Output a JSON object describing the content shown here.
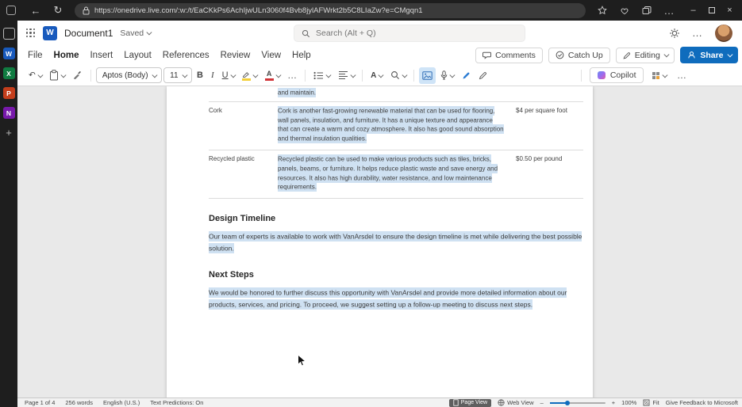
{
  "colors": {
    "accent": "#0f6cbd",
    "highlight": "#cfe1f2",
    "wordblue": "#185abd",
    "excelgreen": "#107c41",
    "pptorange": "#c43e1c",
    "onenotepurple": "#7719aa"
  },
  "icons_text": {
    "back": "←",
    "refresh": "↻",
    "undo": "↶",
    "dots": "…",
    "minimize": "–",
    "close": "×",
    "plus": "+",
    "minus": "–"
  },
  "browser": {
    "url": "https://onedrive.live.com/:w:/t/EaCKkPs6AchIjwULn3060f4Bvb8jylAFWrkt2b5C8LIaZw?e=CMgqn1"
  },
  "sidebar": {
    "apps": [
      {
        "letter": ""
      },
      {
        "letter": "W"
      },
      {
        "letter": "X"
      },
      {
        "letter": "P"
      },
      {
        "letter": "N"
      },
      {
        "letter": "+"
      }
    ]
  },
  "header": {
    "logo_letter": "W",
    "title": "Document1",
    "saved": "Saved",
    "search_placeholder": "Search (Alt + Q)"
  },
  "menu": {
    "items": [
      "File",
      "Home",
      "Insert",
      "Layout",
      "References",
      "Review",
      "View",
      "Help"
    ],
    "comments": "Comments",
    "catch_up": "Catch Up",
    "editing": "Editing",
    "share": "Share"
  },
  "ribbon": {
    "font_name": "Aptos (Body)",
    "font_size": "11",
    "bold": "B",
    "italic": "I",
    "underline": "U",
    "font_color_letter": "A",
    "styles_letter": "A",
    "copilot": "Copilot"
  },
  "document": {
    "cropped_line": "and maintain.",
    "table": {
      "rows": [
        {
          "name": "Cork",
          "description": "Cork is another fast-growing renewable material that can be used for flooring, wall panels, insulation, and furniture. It has a unique texture and appearance that can create a warm and cozy atmosphere. It also has good sound absorption and thermal insulation qualities.",
          "price": "$4 per square foot"
        },
        {
          "name": "Recycled plastic",
          "description": "Recycled plastic can be used to make various products such as tiles, bricks, panels, beams, or furniture. It helps reduce plastic waste and save energy and resources. It also has high durability, water resistance, and low maintenance requirements.",
          "price": "$0.50 per pound"
        }
      ]
    },
    "sections": [
      {
        "heading": "Design Timeline",
        "body": "Our team of experts is available to work with VanArsdel to ensure the design timeline is met while delivering the best possible solution."
      },
      {
        "heading": "Next Steps",
        "body": "We would be honored to further discuss this opportunity with VanArsdel and provide more detailed information about our products, services, and pricing. To proceed, we suggest setting up a follow-up meeting to discuss next steps."
      }
    ]
  },
  "status": {
    "page": "Page 1 of 4",
    "words": "256 words",
    "language": "English (U.S.)",
    "predictions": "Text Predictions: On",
    "page_view": "Page View",
    "web_view": "Web View",
    "zoom": "100%",
    "fit": "Fit",
    "feedback": "Give Feedback to Microsoft"
  }
}
